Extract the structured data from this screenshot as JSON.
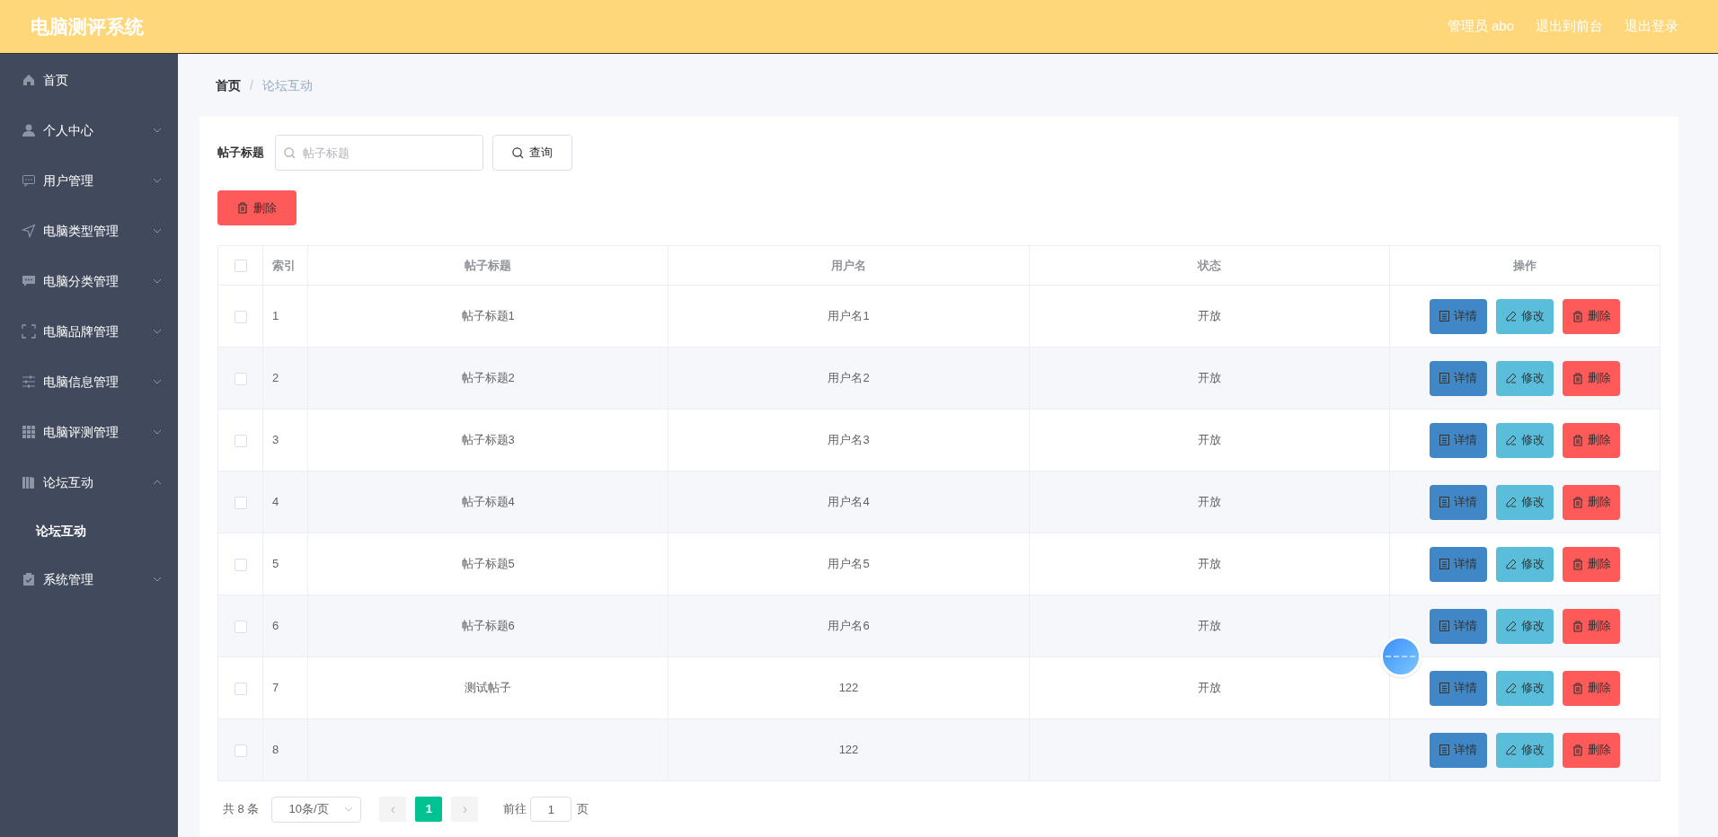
{
  "header": {
    "title": "电脑测评系统",
    "links": [
      "管理员 abo",
      "退出到前台",
      "退出登录"
    ]
  },
  "sidebar": {
    "items": [
      {
        "label": "首页"
      },
      {
        "label": "个人中心",
        "expanded": false
      },
      {
        "label": "用户管理",
        "expanded": false
      },
      {
        "label": "电脑类型管理",
        "expanded": false
      },
      {
        "label": "电脑分类管理",
        "expanded": false
      },
      {
        "label": "电脑品牌管理",
        "expanded": false
      },
      {
        "label": "电脑信息管理",
        "expanded": false
      },
      {
        "label": "电脑评测管理",
        "expanded": false
      },
      {
        "label": "论坛互动",
        "expanded": true,
        "children": [
          {
            "label": "论坛互动",
            "selected": true
          }
        ]
      },
      {
        "label": "系统管理",
        "expanded": false
      }
    ]
  },
  "breadcrumb": [
    "首页",
    "/",
    "论坛互动"
  ],
  "search": {
    "label": "帖子标题",
    "placeholder": "帖子标题",
    "button": "查询"
  },
  "delete_button": "删除",
  "table": {
    "header_checked": false,
    "columns": [
      "索引",
      "帖子标题",
      "用户名",
      "状态",
      "操作"
    ],
    "rows": [
      {
        "checked": false,
        "cells": [
          "1",
          "帖子标题1",
          "用户名1",
          "开放"
        ],
        "actions": [
          {
            "kind": "detail",
            "label": "详情"
          },
          {
            "kind": "edit",
            "label": "修改"
          },
          {
            "kind": "delete",
            "label": "删除"
          }
        ]
      },
      {
        "checked": false,
        "cells": [
          "2",
          "帖子标题2",
          "用户名2",
          "开放"
        ],
        "actions": [
          {
            "kind": "detail",
            "label": "详情"
          },
          {
            "kind": "edit",
            "label": "修改"
          },
          {
            "kind": "delete",
            "label": "删除"
          }
        ]
      },
      {
        "checked": false,
        "cells": [
          "3",
          "帖子标题3",
          "用户名3",
          "开放"
        ],
        "actions": [
          {
            "kind": "detail",
            "label": "详情"
          },
          {
            "kind": "edit",
            "label": "修改"
          },
          {
            "kind": "delete",
            "label": "删除"
          }
        ]
      },
      {
        "checked": false,
        "cells": [
          "4",
          "帖子标题4",
          "用户名4",
          "开放"
        ],
        "actions": [
          {
            "kind": "detail",
            "label": "详情"
          },
          {
            "kind": "edit",
            "label": "修改"
          },
          {
            "kind": "delete",
            "label": "删除"
          }
        ]
      },
      {
        "checked": false,
        "cells": [
          "5",
          "帖子标题5",
          "用户名5",
          "开放"
        ],
        "actions": [
          {
            "kind": "detail",
            "label": "详情"
          },
          {
            "kind": "edit",
            "label": "修改"
          },
          {
            "kind": "delete",
            "label": "删除"
          }
        ]
      },
      {
        "checked": false,
        "cells": [
          "6",
          "帖子标题6",
          "用户名6",
          "开放"
        ],
        "actions": [
          {
            "kind": "detail",
            "label": "详情"
          },
          {
            "kind": "edit",
            "label": "修改"
          },
          {
            "kind": "delete",
            "label": "删除"
          }
        ]
      },
      {
        "checked": false,
        "cells": [
          "7",
          "测试帖子",
          "122",
          "开放"
        ],
        "actions": [
          {
            "kind": "detail",
            "label": "详情"
          },
          {
            "kind": "edit",
            "label": "修改"
          },
          {
            "kind": "delete",
            "label": "删除"
          }
        ]
      },
      {
        "checked": false,
        "cells": [
          "8",
          "",
          "122",
          ""
        ],
        "actions": [
          {
            "kind": "detail",
            "label": "详情"
          },
          {
            "kind": "edit",
            "label": "修改"
          },
          {
            "kind": "delete",
            "label": "删除"
          }
        ]
      }
    ]
  },
  "pagination": {
    "total": "共 8 条",
    "page_size": "10条/页",
    "prev": "‹",
    "pages": [
      {
        "label": "1",
        "selected": true
      }
    ],
    "next": "›",
    "goto_label": "前往",
    "goto_value": "1",
    "goto_suffix": "页"
  }
}
